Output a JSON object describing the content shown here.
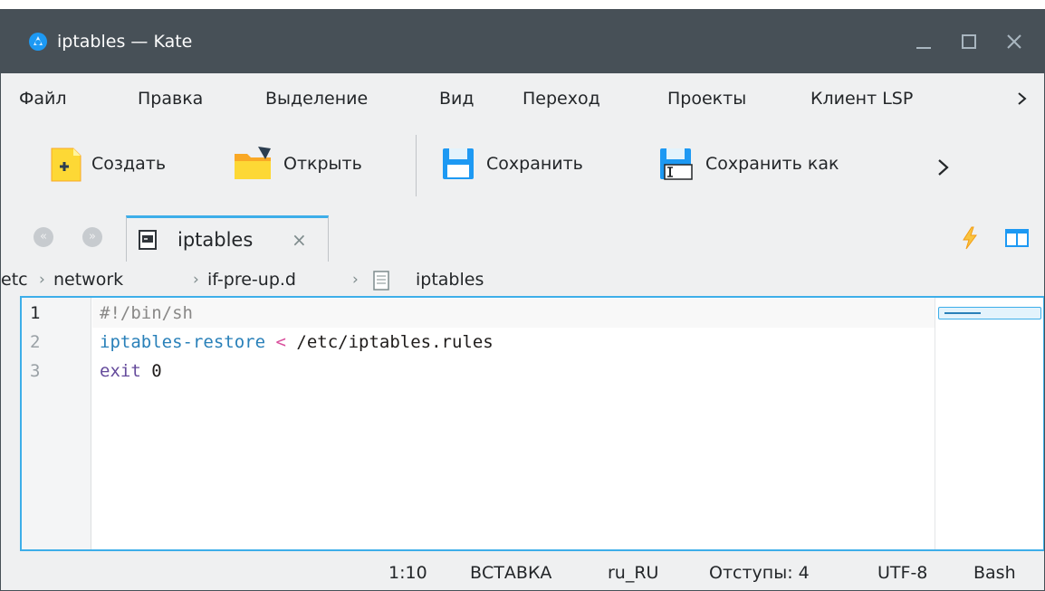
{
  "window": {
    "title": "iptables — Kate",
    "controls": {
      "minimize": "minimize",
      "maximize": "maximize",
      "close": "close"
    }
  },
  "menu": {
    "items": [
      "Файл",
      "Правка",
      "Выделение",
      "Вид",
      "Переход",
      "Проекты",
      "Клиент LSP"
    ],
    "more_icon": "chevron-right-icon"
  },
  "toolbar": {
    "new_label": "Создать",
    "open_label": "Открыть",
    "save_label": "Сохранить",
    "save_as_label": "Сохранить как",
    "more_icon": "chevron-right-icon"
  },
  "tabs": {
    "active": {
      "label": "iptables",
      "close_symbol": "×"
    }
  },
  "breadcrumb": {
    "items": [
      "etc",
      "network",
      "if-pre-up.d",
      "iptables"
    ],
    "separator": "›"
  },
  "editor": {
    "line_numbers": [
      "1",
      "2",
      "3"
    ],
    "lines": [
      [
        {
          "t": "#!/bin/sh",
          "c": "comment"
        }
      ],
      [
        {
          "t": "iptables-restore",
          "c": "cmd"
        },
        {
          "t": " ",
          "c": "text"
        },
        {
          "t": "<",
          "c": "op"
        },
        {
          "t": " /etc/iptables.rules",
          "c": "text"
        }
      ],
      [
        {
          "t": "exit",
          "c": "kw"
        },
        {
          "t": " 0",
          "c": "num"
        }
      ]
    ]
  },
  "statusbar": {
    "cursor": "1:10",
    "mode": "ВСТАВКА",
    "language": "ru_RU",
    "indent": "Отступы: 4",
    "encoding": "UTF-8",
    "syntax": "Bash"
  },
  "colors": {
    "titlebar": "#475057",
    "accent": "#3daee9",
    "window_bg": "#eff0f1"
  }
}
